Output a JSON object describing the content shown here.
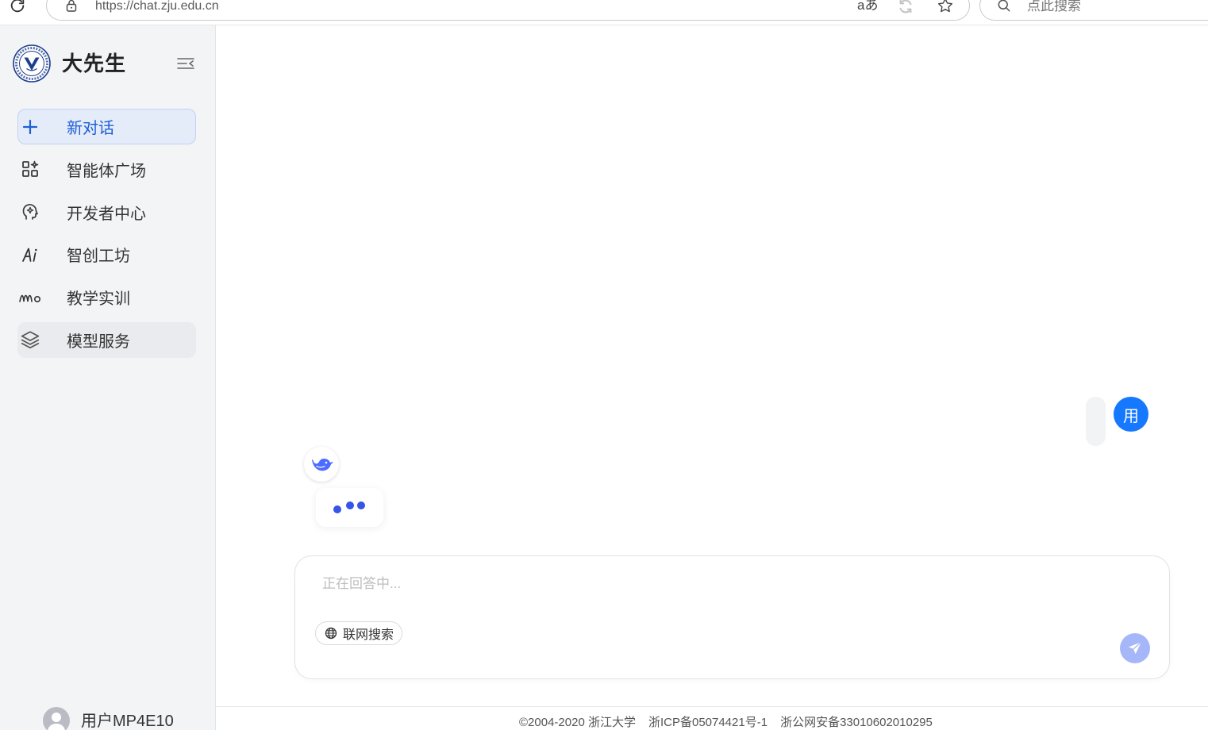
{
  "browser": {
    "url": "https://chat.zju.edu.cn",
    "translate_icon": "aあ",
    "search_placeholder": "点此搜索"
  },
  "sidebar": {
    "brand": "大先生",
    "new_chat": "新对话",
    "new_chat_icon": "plus-icon",
    "items": [
      {
        "label": "智能体广场",
        "icon": "apps-icon"
      },
      {
        "label": "开发者中心",
        "icon": "head-idea-icon"
      },
      {
        "label": "智创工坊",
        "icon": "ai-icon"
      },
      {
        "label": "教学实训",
        "icon": "wave-icon"
      },
      {
        "label": "模型服务",
        "icon": "layers-icon"
      }
    ],
    "user": {
      "name": "用户MP4E10"
    }
  },
  "chat": {
    "user_avatar_text": "用",
    "input_placeholder": "正在回答中...",
    "web_search_label": "联网搜索"
  },
  "footer": {
    "copyright": "©2004-2020 浙江大学",
    "icp": "浙ICP备05074421号-1",
    "police": "浙公网安备33010602010295"
  },
  "theme": {
    "accent": "#1e5fd6",
    "user_avatar": "#1677ff",
    "send_button": "#a5b7f8",
    "loading_dots": "#3654e8",
    "bot_icon": "#4d6bfe",
    "sidebar_bg": "#f3f4f6"
  }
}
